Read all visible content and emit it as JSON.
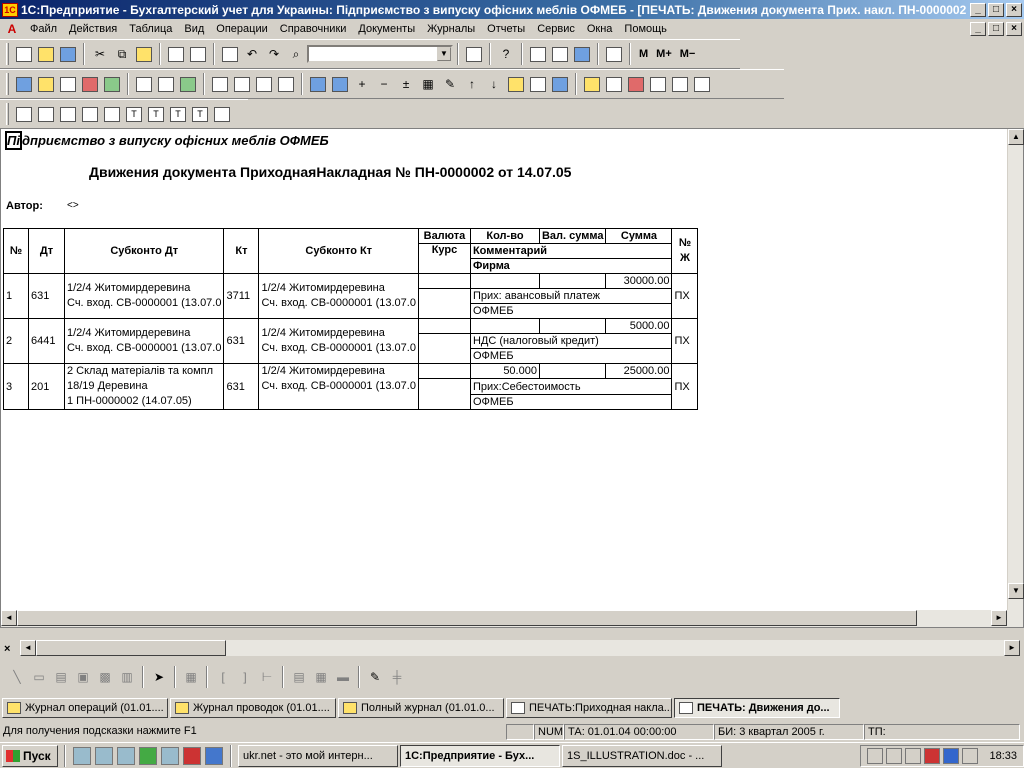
{
  "window": {
    "title": "1С:Предприятие - Бухгалтерский учет для Украины: Підприємство з випуску офісних меблів ОФМЕБ - [ПЕЧАТЬ: Движения документа Прих. накл. ПН-0000002 (1...",
    "minimize": "_",
    "maximize": "□",
    "close": "×"
  },
  "menu": [
    "Файл",
    "Действия",
    "Таблица",
    "Вид",
    "Операции",
    "Справочники",
    "Документы",
    "Журналы",
    "Отчеты",
    "Сервис",
    "Окна",
    "Помощь"
  ],
  "toolbar": {
    "m": "M",
    "m_plus": "M+",
    "m_minus": "M−"
  },
  "document": {
    "company": "Підприємство з випуску офісних меблів ОФМЕБ",
    "company_cursor": "Пі",
    "company_rest": "дприємство з випуску офісних меблів ОФМЕБ",
    "title": "Движения документа ПриходнаяНакладная № ПН-0000002 от 14.07.05",
    "author_label": "Автор:",
    "author_value": "<>",
    "headers": {
      "no": "№",
      "dt": "Дт",
      "sub_dt": "Субконто Дт",
      "kt": "Кт",
      "sub_kt": "Субконто Кт",
      "currency": "Валюта",
      "qty": "Кол-во",
      "cur_sum": "Вал. сумма",
      "sum": "Сумма",
      "rate": "Курс",
      "comment": "Комментарий",
      "firm": "Фирма",
      "journal": "№ Ж"
    },
    "rows": [
      {
        "no": "1",
        "dt": "631",
        "sub_dt": [
          "1/2/4 Житомирдеревина",
          "Сч. вход. СВ-0000001 (13.07.0"
        ],
        "kt": "3711",
        "sub_kt": [
          "1/2/4 Житомирдеревина",
          "Сч. вход. СВ-0000001 (13.07.0"
        ],
        "qty": "",
        "sum": "30000.00",
        "comment": "Прих: авансовый платеж",
        "firm": "ОФМЕБ",
        "journal": "ПХ"
      },
      {
        "no": "2",
        "dt": "6441",
        "sub_dt": [
          "1/2/4 Житомирдеревина",
          "Сч. вход. СВ-0000001 (13.07.0"
        ],
        "kt": "631",
        "sub_kt": [
          "1/2/4 Житомирдеревина",
          "Сч. вход. СВ-0000001 (13.07.0"
        ],
        "qty": "",
        "sum": "5000.00",
        "comment": "НДС (налоговый кредит)",
        "firm": "ОФМЕБ",
        "journal": "ПХ"
      },
      {
        "no": "3",
        "dt": "201",
        "sub_dt": [
          "2 Склад матеріалів та компл",
          "18/19 Деревина",
          "1 ПН-0000002 (14.07.05)"
        ],
        "kt": "631",
        "sub_kt": [
          "1/2/4 Житомирдеревина",
          "Сч. вход. СВ-0000001 (13.07.0",
          ""
        ],
        "qty": "50.000",
        "sum": "25000.00",
        "comment": "Прих:Себестоимость",
        "firm": "ОФМЕБ",
        "journal": "ПХ"
      }
    ]
  },
  "window_tabs": [
    {
      "label": "Журнал операций (01.01...."
    },
    {
      "label": "Журнал проводок (01.01...."
    },
    {
      "label": "Полный журнал (01.01.0..."
    },
    {
      "label": "ПЕЧАТЬ:Приходная накла..."
    },
    {
      "label": "ПЕЧАТЬ: Движения до...",
      "active": true
    }
  ],
  "status": {
    "hint": "Для получения подсказки нажмите F1",
    "num": "NUM",
    "ta": "ТА: 01.01.04  00:00:00",
    "bi": "БИ: 3 квартал 2005 г.",
    "tp": "ТП:"
  },
  "taskbar": {
    "start": "Пуск",
    "tasks": [
      {
        "label": "ukr.net - это мой интерн..."
      },
      {
        "label": "1С:Предприятие - Бух...",
        "active": true
      },
      {
        "label": "1S_ILLUSTRATION.doc - ..."
      }
    ],
    "clock": "18:33"
  }
}
